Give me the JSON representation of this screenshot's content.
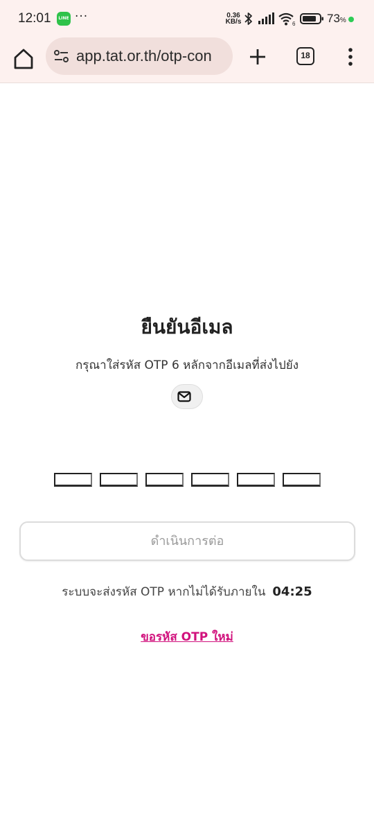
{
  "status_bar": {
    "time": "12:01",
    "line_app": "LINE",
    "more": "···",
    "net_speed_value": "0.36",
    "net_speed_unit": "KB/s",
    "battery_value": "73",
    "battery_unit": "%",
    "indicator_color": "#2ecc55"
  },
  "browser": {
    "url": "app.tat.or.th/otp-con",
    "tab_count": "18",
    "toolbar_bg": "#fdf1ef",
    "url_bg": "#f1dfdc"
  },
  "page": {
    "title": "ยืนยันอีเมล",
    "subtitle": "กรุณาใส่รหัส OTP 6 หลักจากอีเมลที่ส่งไปยัง",
    "email_icon": "mail-icon",
    "otp_slots": [
      "",
      "",
      "",
      "",
      "",
      ""
    ],
    "continue_label": "ดำเนินการต่อ",
    "resend_info": "ระบบจะส่งรหัส OTP หากไม่ได้รับภายใน",
    "timer": "04:25",
    "resend_link": "ขอรหัส OTP ใหม่",
    "accent_color": "#d1127d"
  }
}
